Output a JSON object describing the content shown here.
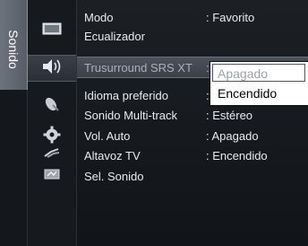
{
  "category": {
    "label": "Sonido"
  },
  "menu": {
    "items": [
      {
        "label": "Modo",
        "value": ": Favorito"
      },
      {
        "label": "Ecualizador",
        "value": ""
      },
      {
        "label": "Trusurround SRS XT",
        "value": ":"
      },
      {
        "label": "Idioma preferido",
        "value": ":"
      },
      {
        "label": "Sonido Multi-track",
        "value": ": Estéreo"
      },
      {
        "label": "Vol. Auto",
        "value": ": Apagado"
      },
      {
        "label": "Altavoz TV",
        "value": ": Encendido"
      },
      {
        "label": "Sel. Sonido",
        "value": ""
      }
    ]
  },
  "dropdown": {
    "options": [
      "Apagado",
      "Encendido"
    ],
    "selected": "Apagado"
  },
  "icons": [
    "screen-icon",
    "speaker-icon",
    "satellite-dish-icon",
    "gear-icon",
    "input-plug-icon",
    "remote-icon"
  ],
  "colors": {
    "tab": "#6c737c",
    "highlight": "#4b525b"
  }
}
